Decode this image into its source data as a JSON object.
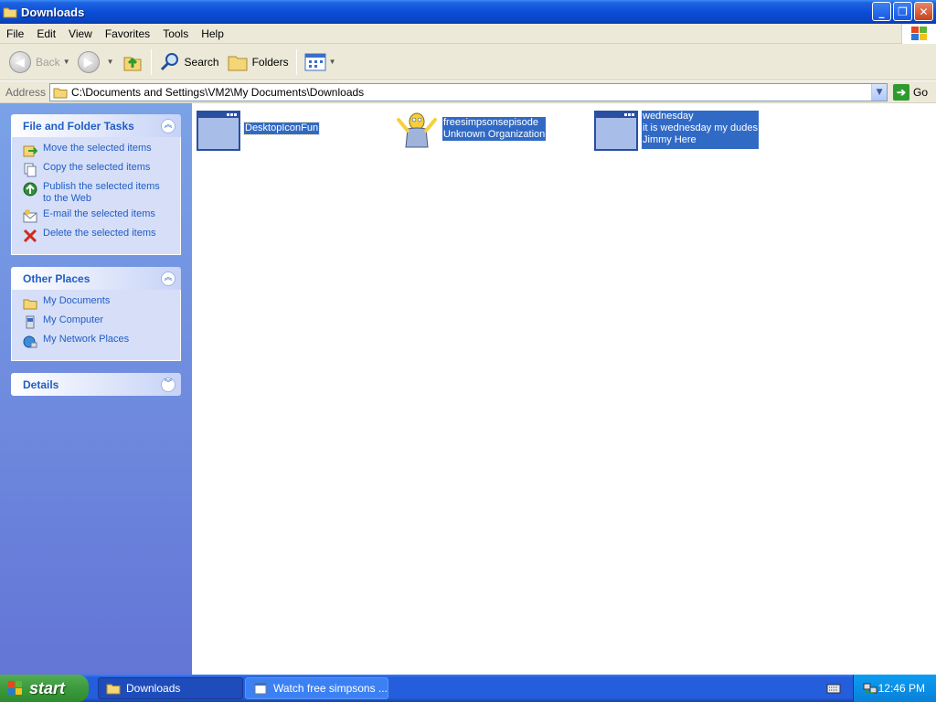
{
  "window": {
    "title": "Downloads"
  },
  "menu": [
    "File",
    "Edit",
    "View",
    "Favorites",
    "Tools",
    "Help"
  ],
  "toolbar": {
    "back": "Back",
    "search": "Search",
    "folders": "Folders"
  },
  "address": {
    "label": "Address",
    "path": "C:\\Documents and Settings\\VM2\\My Documents\\Downloads",
    "go": "Go"
  },
  "tasks": {
    "title": "File and Folder Tasks",
    "items": [
      {
        "label": "Move the selected items",
        "icon": "move-icon"
      },
      {
        "label": "Copy the selected items",
        "icon": "copy-icon"
      },
      {
        "label": "Publish the selected items to the Web",
        "icon": "globe-icon"
      },
      {
        "label": "E-mail the selected items",
        "icon": "email-icon"
      },
      {
        "label": "Delete the selected items",
        "icon": "delete-icon"
      }
    ]
  },
  "places": {
    "title": "Other Places",
    "items": [
      {
        "label": "My Documents",
        "icon": "folder-icon"
      },
      {
        "label": "My Computer",
        "icon": "computer-icon"
      },
      {
        "label": "My Network Places",
        "icon": "network-icon"
      }
    ]
  },
  "details": {
    "title": "Details"
  },
  "files": [
    {
      "lines": [
        "DesktopIconFun"
      ],
      "icon": "window-app-icon"
    },
    {
      "lines": [
        "freesimpsonsepisode",
        "Unknown Organization"
      ],
      "icon": "homer-icon"
    },
    {
      "lines": [
        "wednesday",
        "it is wednesday my dudes",
        "Jimmy Here"
      ],
      "icon": "window-app-icon"
    }
  ],
  "taskbar": {
    "start": "start",
    "tasks": [
      "Downloads",
      "Watch free simpsons ..."
    ],
    "clock": "12:46 PM"
  },
  "colors": {
    "selection": "#316ac5",
    "link": "#215dc6",
    "titlebar": "#0a4fd8"
  }
}
